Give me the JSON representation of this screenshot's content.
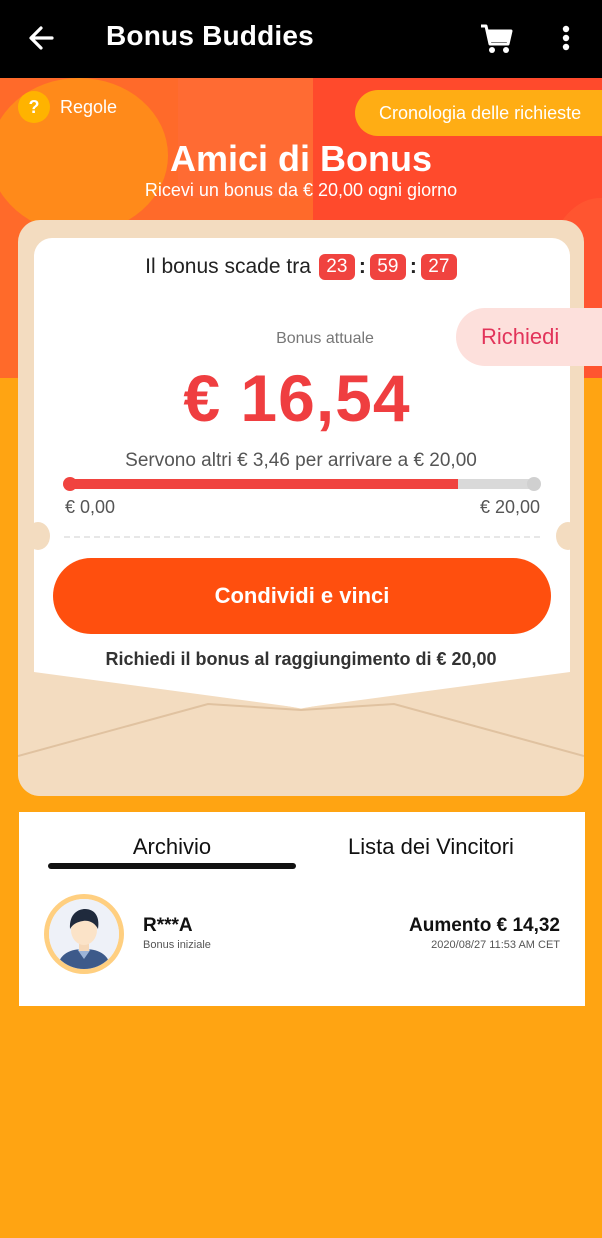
{
  "app_bar": {
    "title": "Bonus Buddies",
    "back_icon": "arrow-left-icon",
    "cart_icon": "cart-icon",
    "more_icon": "more-vert-icon"
  },
  "hero": {
    "rules_label": "Regole",
    "rules_icon": "question-icon",
    "history_label": "Cronologia delle richieste",
    "title": "Amici di Bonus",
    "subtitle": "Ricevi un bonus da € 20,00 ogni giorno"
  },
  "bonus": {
    "expires_label": "Il bonus scade tra",
    "timer": {
      "hours": "23",
      "minutes": "59",
      "seconds": "27"
    },
    "claim_tab": "Richiedi",
    "current_label": "Bonus attuale",
    "amount": "€ 16,54",
    "needed_text": "Servono altri € 3,46 per arrivare a € 20,00",
    "progress": {
      "min_label": "€ 0,00",
      "max_label": "€ 20,00",
      "fraction": 0.827
    },
    "share_button": "Condividi e vinci",
    "claim_hint": "Richiedi il bonus al raggiungimento di € 20,00"
  },
  "history": {
    "tabs": [
      "Archivio",
      "Lista dei Vincitori"
    ],
    "active_tab": 0,
    "entries": [
      {
        "user": "R***A",
        "label": "Bonus iniziale",
        "amount": "Aumento € 14,32",
        "datetime": "2020/08/27 11:53 AM CET"
      }
    ]
  },
  "colors": {
    "accent": "#ff4f0e",
    "amount_red": "#ef3e40",
    "background": "#ffa412"
  }
}
